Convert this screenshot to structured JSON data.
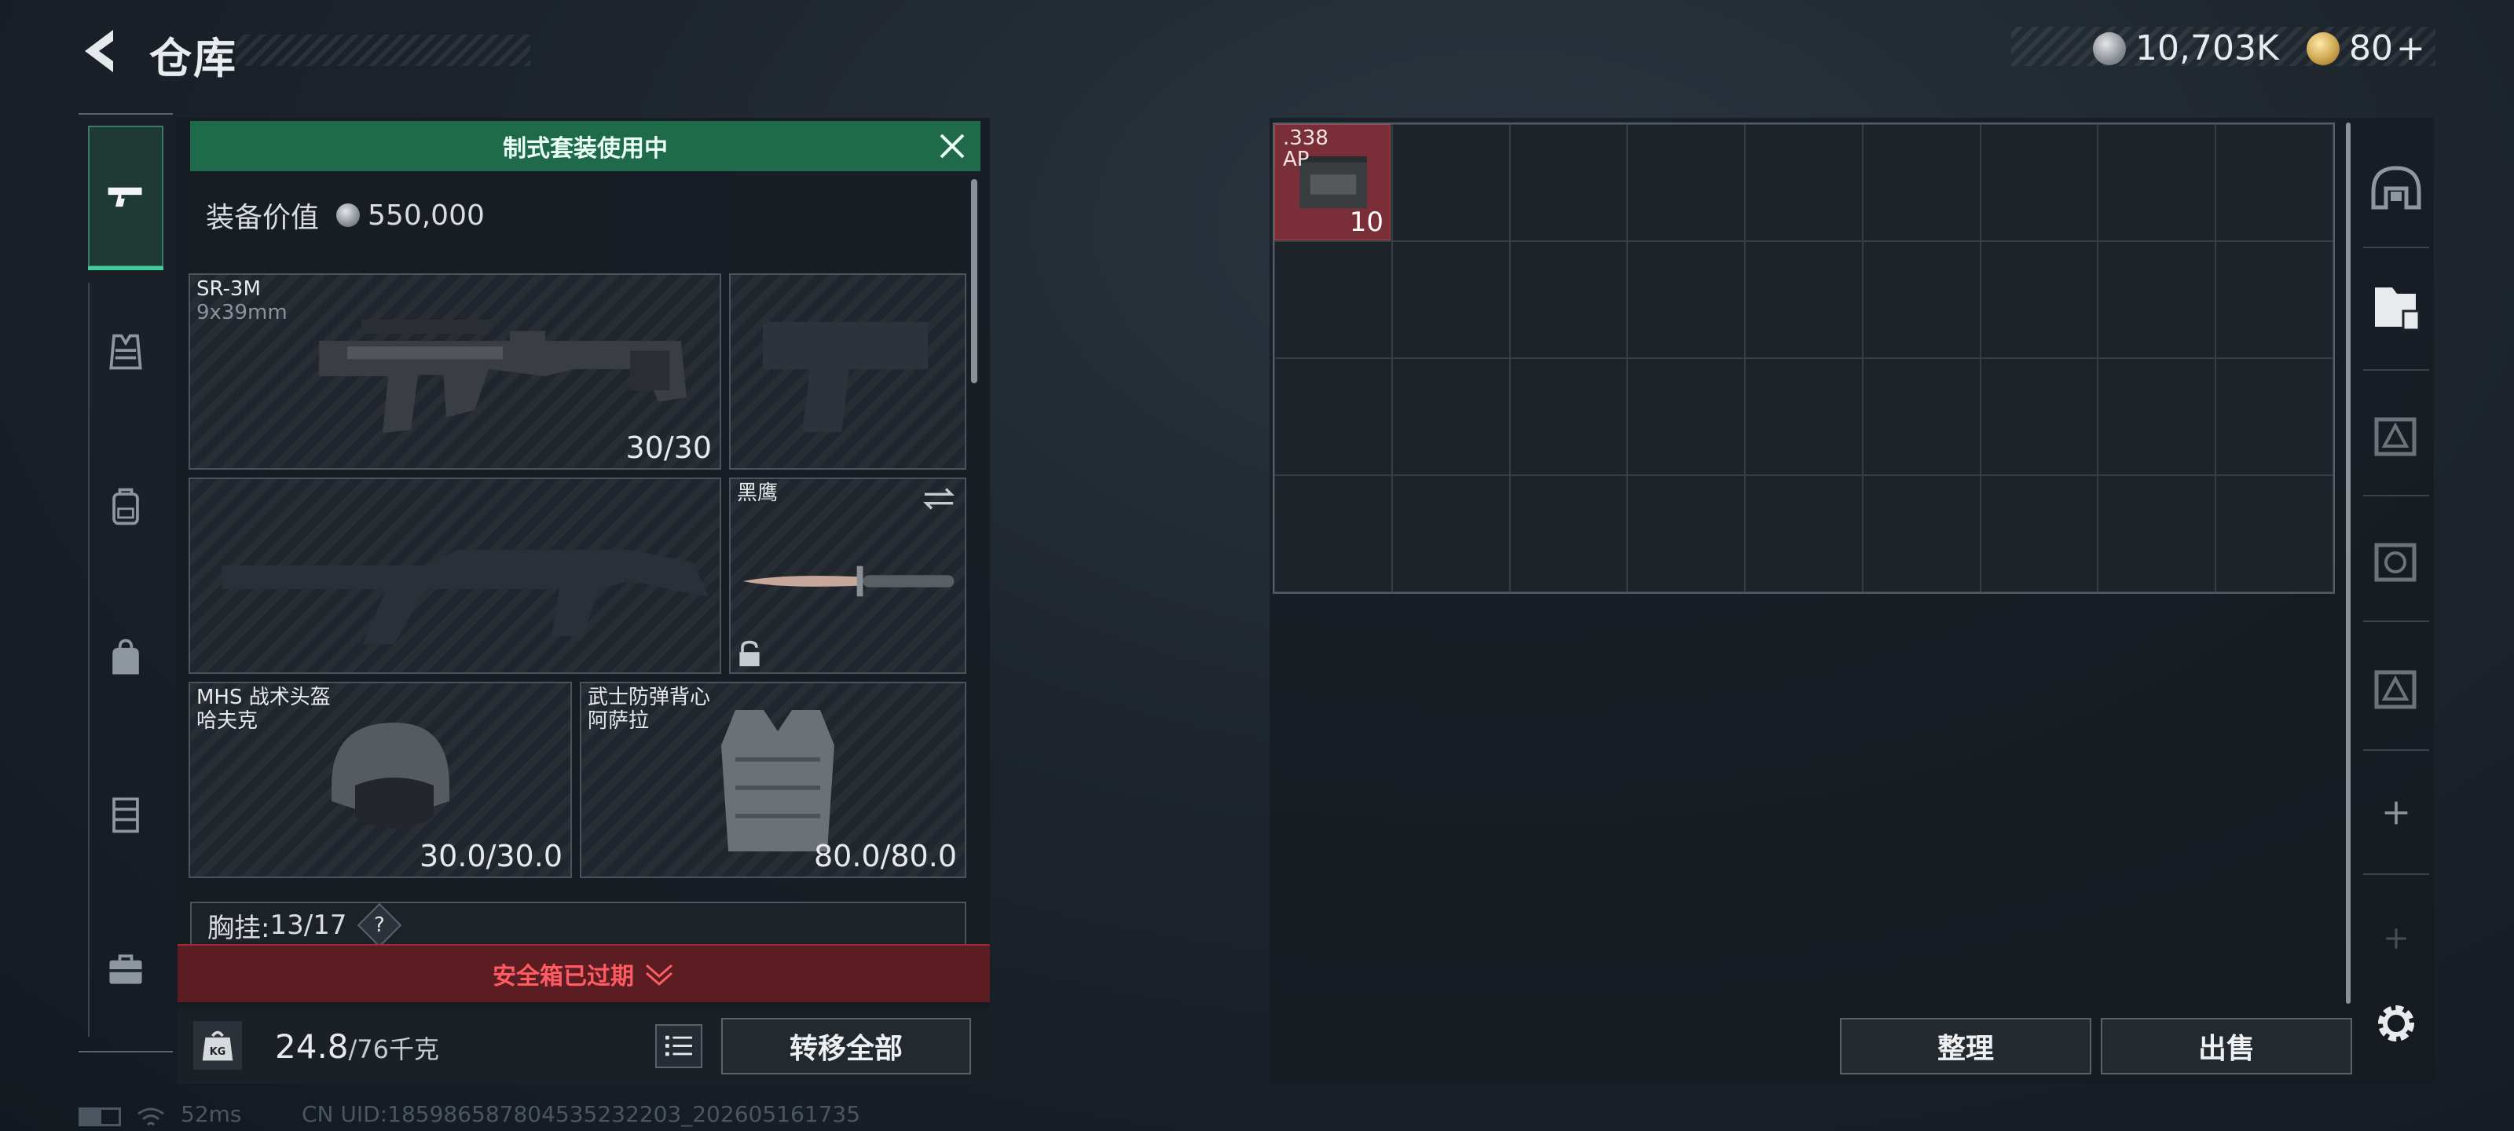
{
  "header": {
    "title": "仓库",
    "silver_amount": "10,703K",
    "gold_amount": "80",
    "gold_plus": "+"
  },
  "categories": [
    "pistol-icon",
    "armor-vest-icon",
    "backpack-icon",
    "bag-icon",
    "chest-rig-icon",
    "briefcase-icon"
  ],
  "loadout": {
    "kit_banner": "制式套装使用中",
    "value_label": "装备价值",
    "value_amount": "550,000",
    "primary": {
      "name": "SR-3M",
      "caliber": "9x39mm",
      "ammo": "30/30"
    },
    "melee": {
      "name": "黑鹰"
    },
    "helmet": {
      "name": "MHS 战术头盔",
      "sub": "哈夫克",
      "durability": "30.0/30.0"
    },
    "armor": {
      "name": "武士防弹背心",
      "sub": "阿萨拉",
      "durability": "80.0/80.0"
    },
    "chest_rig": {
      "label": "胸挂:",
      "capacity": "13/17",
      "help": "?"
    },
    "safebox": "安全箱已过期",
    "weight_current": "24.8",
    "weight_max": "/76千克",
    "weight_icon_label": "KG",
    "transfer_all": "转移全部"
  },
  "stash": {
    "item": {
      "name_line1": ".338",
      "name_line2": "AP",
      "quantity": "10"
    },
    "sort_button": "整理",
    "sell_button": "出售"
  },
  "status_bar": {
    "ping": "52ms",
    "uid": "CN UID:18598658780453523220​3_202605161735"
  },
  "colors": {
    "active_tab": "#3fcf9a",
    "kit_banner": "#1f6a4b",
    "safebox_warning": "#ff5b63",
    "ammo_rarity": "#7a2f38"
  }
}
